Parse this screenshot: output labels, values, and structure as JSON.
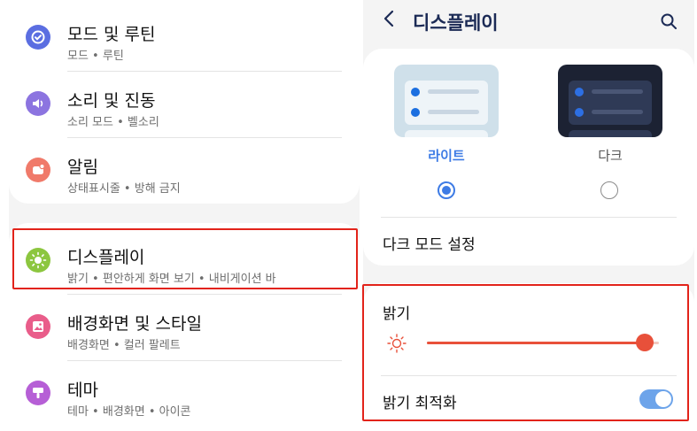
{
  "colors": {
    "accent": "#3d7be5",
    "slider": "#e8503a",
    "highlight": "#e2231a",
    "toggle_on": "#6da4ea"
  },
  "left": {
    "items": [
      {
        "title": "모드 및 루틴",
        "subtitle": "모드 • 루틴",
        "icon": "modes-routines-icon",
        "icon_color": "#5b6ee1"
      },
      {
        "title": "소리 및 진동",
        "subtitle": "소리 모드 • 벨소리",
        "icon": "volume-icon",
        "icon_color": "#8c74e0"
      },
      {
        "title": "알림",
        "subtitle": "상태표시줄 • 방해 금지",
        "icon": "notification-icon",
        "icon_color": "#f07a6a"
      },
      {
        "title": "디스플레이",
        "subtitle": "밝기 • 편안하게 화면 보기 • 내비게이션 바",
        "icon": "display-sun-icon",
        "icon_color": "#8cc63f"
      },
      {
        "title": "배경화면 및 스타일",
        "subtitle": "배경화면 • 컬러 팔레트",
        "icon": "wallpaper-icon",
        "icon_color": "#e95d8a"
      },
      {
        "title": "테마",
        "subtitle": "테마 • 배경화면 • 아이콘",
        "icon": "theme-icon",
        "icon_color": "#b65fd6"
      }
    ]
  },
  "right": {
    "header": {
      "back": "<",
      "title": "디스플레이",
      "search_icon": "search-icon"
    },
    "theme": {
      "light_label": "라이트",
      "dark_label": "다크",
      "selected": "light"
    },
    "dark_mode_setting": "다크 모드 설정",
    "brightness": {
      "title": "밝기",
      "level": 0.94
    },
    "adaptive_brightness": {
      "title": "밝기 최적화",
      "enabled": true
    }
  }
}
